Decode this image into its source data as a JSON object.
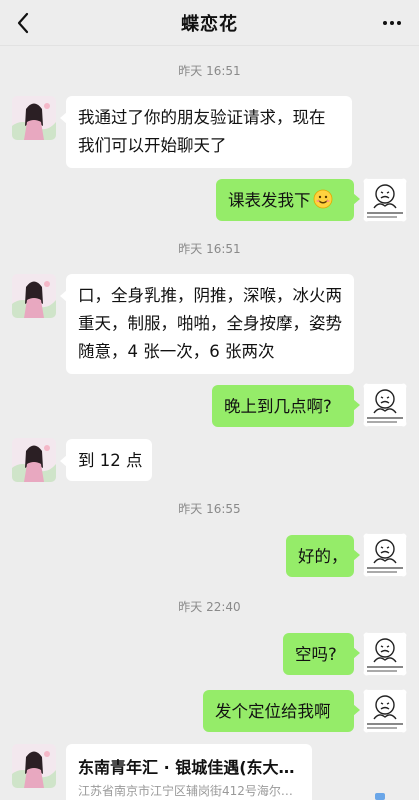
{
  "header": {
    "title": "蝶恋花",
    "back_icon": "chevron-left-icon",
    "more_icon": "more-dots-icon"
  },
  "timestamps": [
    "昨天 16:51",
    "昨天 16:51",
    "昨天 16:55",
    "昨天 22:40"
  ],
  "messages": [
    {
      "side": "in",
      "text": "我通过了你的朋友验证请求，现在我们可以开始聊天了"
    },
    {
      "side": "out",
      "text": "课表发我下",
      "emoji": "smile-emoji-icon"
    },
    {
      "side": "in",
      "text": "口，全身乳推，阴推，深喉，冰火两重天，制服，啪啪，全身按摩，姿势随意，4 张一次，6 张两次"
    },
    {
      "side": "out",
      "text": "晚上到几点啊?"
    },
    {
      "side": "in",
      "text": "到 12 点"
    },
    {
      "side": "out",
      "text": "好的，"
    },
    {
      "side": "out",
      "text": "空吗?"
    },
    {
      "side": "out",
      "text": "发个定位给我啊"
    }
  ],
  "location_card": {
    "title": "东南青年汇 · 银城佳遇(东大…",
    "address": "江苏省南京市江宁区辅岗街412号海尔…"
  },
  "colors": {
    "background": "#ededed",
    "incoming_bubble": "#ffffff",
    "outgoing_bubble": "#95ec69",
    "timestamp_text": "#8a8a8a"
  }
}
